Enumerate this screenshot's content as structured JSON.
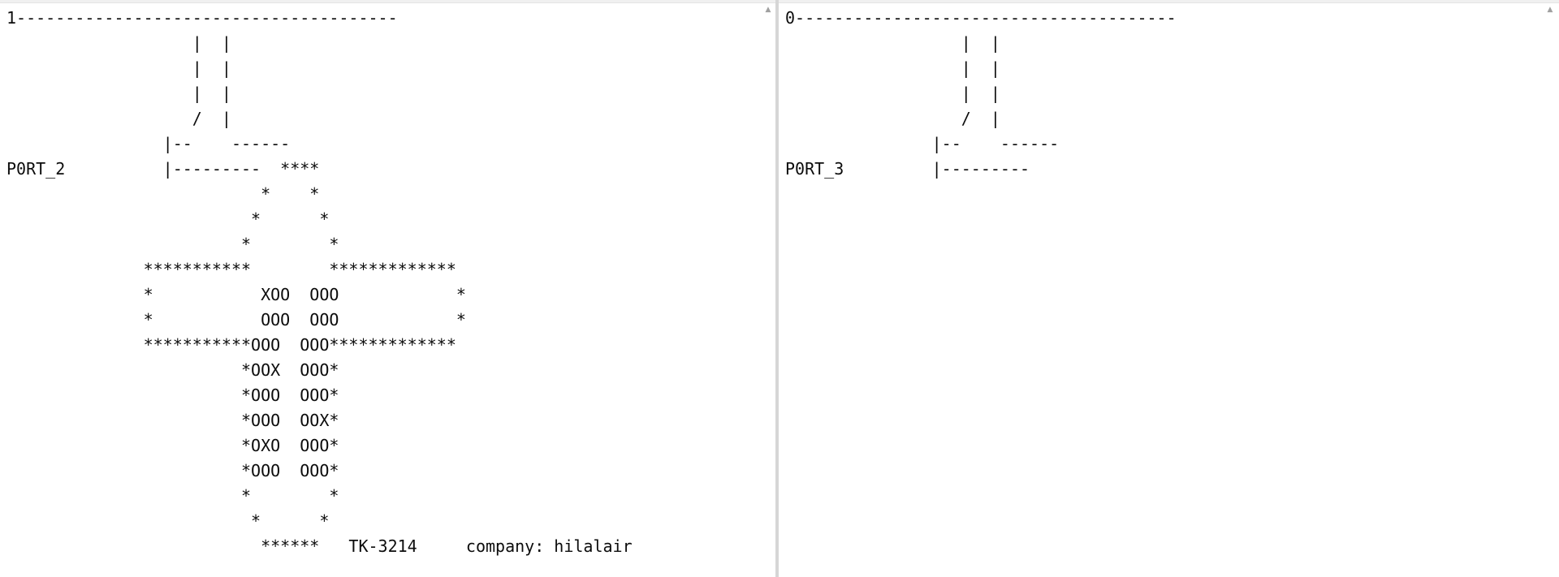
{
  "left_console": {
    "lines": [
      "1---------------------------------------",
      "                   |  |",
      "                   |  |",
      "                   |  |",
      "                   /  |",
      "                |--    ------",
      "P0RT_2          |---------  ****",
      "                          *    *",
      "                         *      *",
      "                        *        *",
      "              ***********        *************",
      "              *           XOO  OOO            *",
      "              *           OOO  OOO            *",
      "              ***********OOO  OOO*************",
      "                        *OOX  OOO*",
      "                        *OOO  OOO*",
      "                        *OOO  OOX*",
      "                        *OXO  OOO*",
      "                        *OOO  OOO*",
      "                        *        *",
      "                         *      *",
      "                          ******   TK-3214     company: hilalair"
    ]
  },
  "right_console": {
    "lines": [
      "0---------------------------------------",
      "                  |  |",
      "                  |  |",
      "                  |  |",
      "                  /  |",
      "               |--    ------",
      "P0RT_3         |---------"
    ]
  }
}
